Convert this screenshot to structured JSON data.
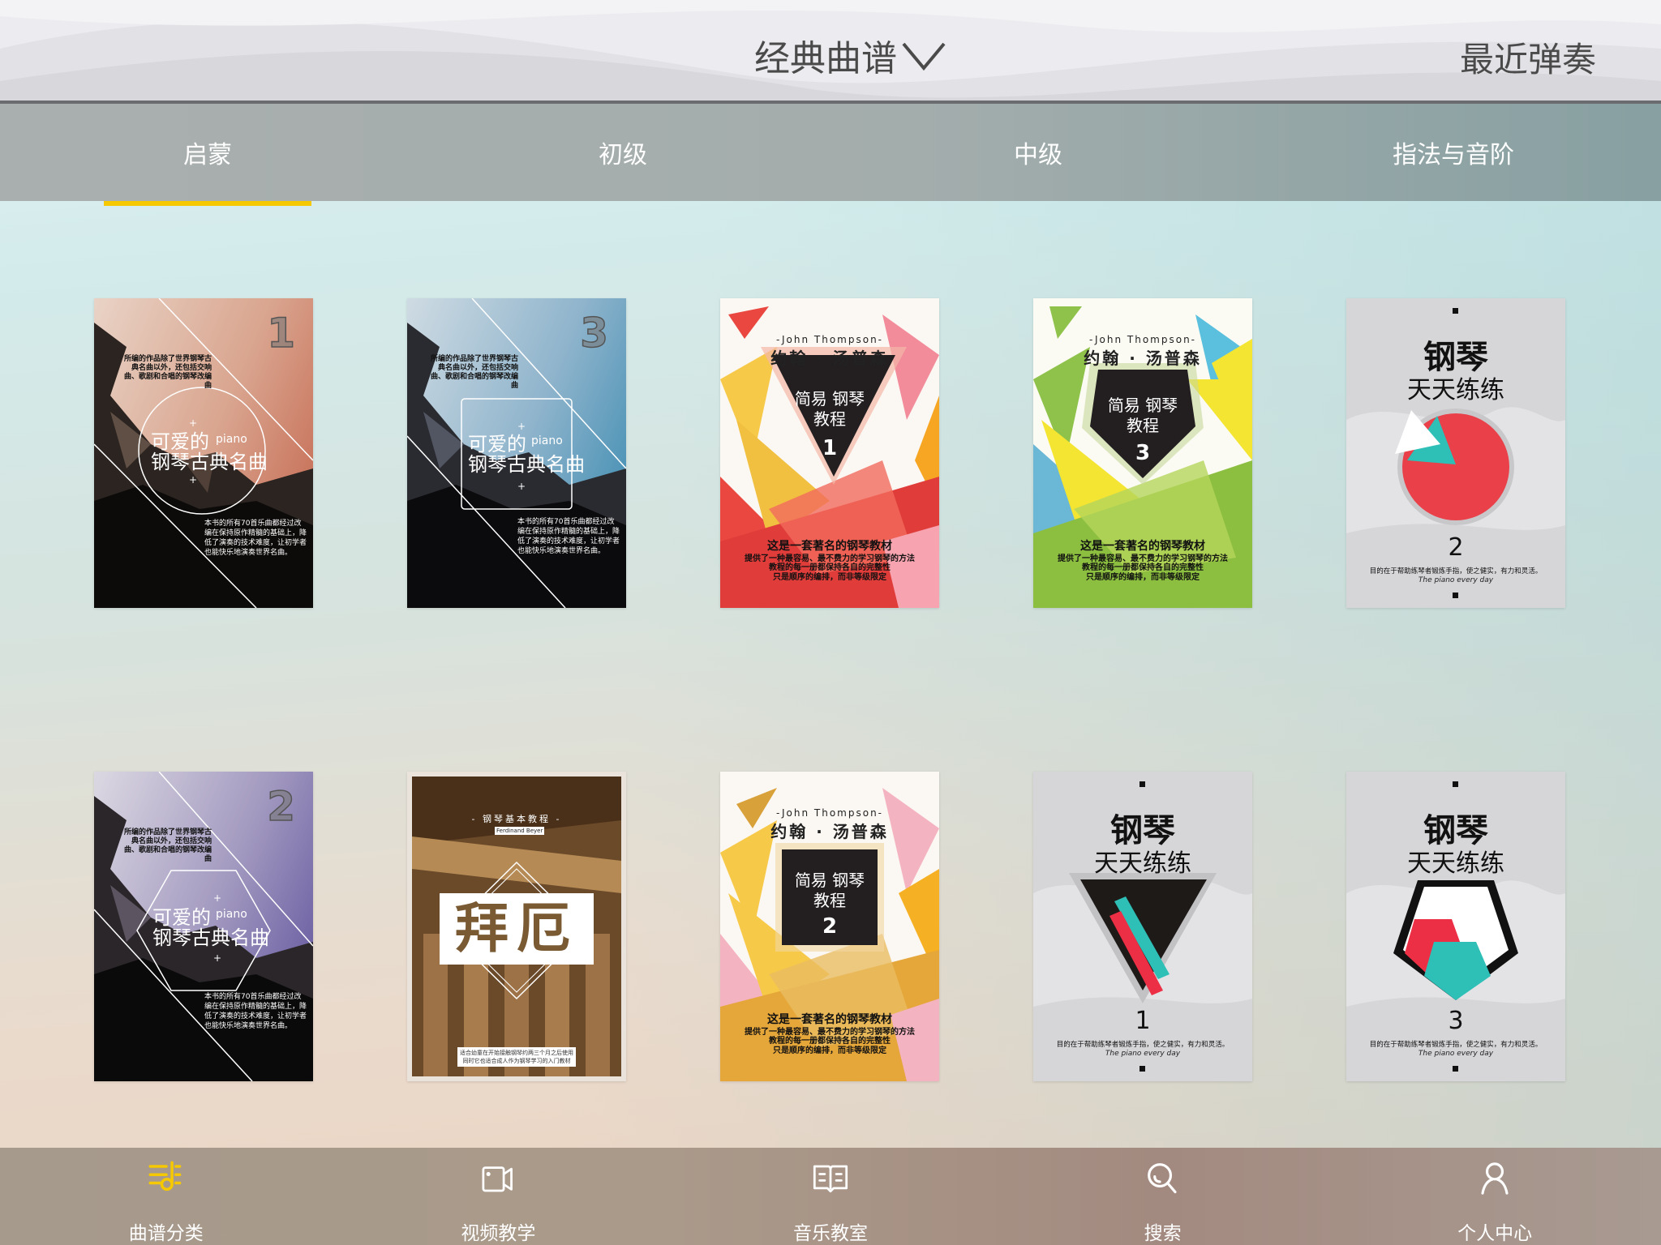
{
  "header": {
    "title": "经典曲谱",
    "title_icon": "chevron-down-icon",
    "recent_label": "最近弹奏"
  },
  "category_tabs": [
    {
      "label": "启蒙",
      "active": true
    },
    {
      "label": "初级",
      "active": false
    },
    {
      "label": "中级",
      "active": false
    },
    {
      "label": "指法与音阶",
      "active": false
    }
  ],
  "colors": {
    "accent": "#f6c800",
    "header_text": "#4a4a4a",
    "tab_text": "#ffffff"
  },
  "books": {
    "classic_common": {
      "desc_top": "所编的作品除了世界钢琴古典名曲以外，还包括交响曲、歌剧和合唱的钢琴改编曲",
      "title_line1": "可爱的",
      "title_line2": "钢琴古典名曲",
      "piano": "piano",
      "desc_bottom": "本书的所有70首乐曲都经过改编在保持原作精髓的基础上，降低了演奏的技术难度，让初学者也能快乐地演奏世界名曲。"
    },
    "thompson_common": {
      "author_en": "-John Thompson-",
      "author_cn": "约翰 · 汤普森",
      "subtitle": "简易 钢琴教程",
      "desc1": "这是一套著名的钢琴教材",
      "desc2": "提供了一种最容易、最不费力的学习钢琴的方法",
      "desc3": "教程的每一册都保持各自的完整性 只是顺序的编排，而非等级限定"
    },
    "daily_common": {
      "title1": "钢琴",
      "title2": "天天练练",
      "desc": "目的在于帮助练琴者锻炼手指，使之健实，有力和灵活。",
      "english": "The piano every day"
    },
    "beyer": {
      "series": "- 钢琴基本教程 -",
      "author": "Ferdinand Beyer",
      "title": "拜厄",
      "desc": "适合幼童在开始接触钢琴约两三个月之后使用 同时它也适合成人作为钢琴学习的入门教材"
    },
    "items": [
      {
        "type": "classic",
        "volume": "1"
      },
      {
        "type": "classic",
        "volume": "3"
      },
      {
        "type": "thompson",
        "volume": "1"
      },
      {
        "type": "thompson",
        "volume": "3"
      },
      {
        "type": "daily",
        "volume": "2"
      },
      {
        "type": "classic",
        "volume": "2"
      },
      {
        "type": "beyer",
        "volume": ""
      },
      {
        "type": "thompson",
        "volume": "2"
      },
      {
        "type": "daily",
        "volume": "1"
      },
      {
        "type": "daily",
        "volume": "3"
      }
    ]
  },
  "bottom_nav": [
    {
      "label": "曲谱分类",
      "icon": "music-score-icon",
      "active": true
    },
    {
      "label": "视频教学",
      "icon": "video-camera-icon",
      "active": false
    },
    {
      "label": "音乐教室",
      "icon": "open-book-icon",
      "active": false
    },
    {
      "label": "搜索",
      "icon": "search-icon",
      "active": false
    },
    {
      "label": "个人中心",
      "icon": "user-icon",
      "active": false
    }
  ]
}
